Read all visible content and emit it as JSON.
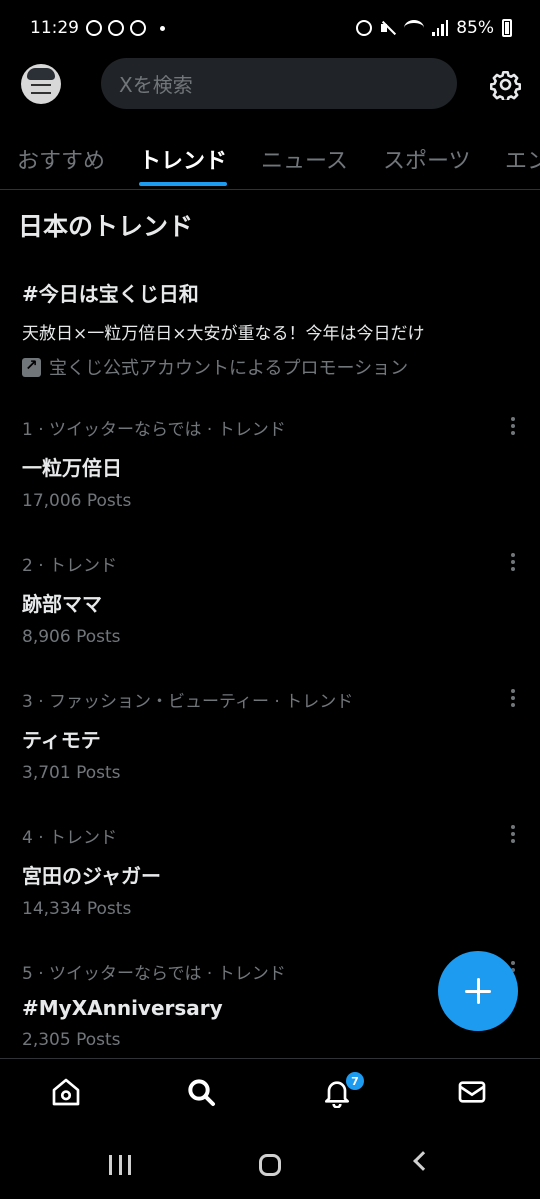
{
  "status_bar": {
    "time": "11:29",
    "battery": "85%"
  },
  "header": {
    "search_placeholder": "Xを検索",
    "avatar_icon": "avatar-icon",
    "settings_icon": "gear-icon"
  },
  "tabs": [
    {
      "label": "おすすめ",
      "active": false
    },
    {
      "label": "トレンド",
      "active": true
    },
    {
      "label": "ニュース",
      "active": false
    },
    {
      "label": "スポーツ",
      "active": false
    },
    {
      "label": "エン",
      "active": false
    }
  ],
  "section_title": "日本のトレンド",
  "promoted": {
    "title": "#今日は宝くじ日和",
    "description": "天赦日×一粒万倍日×大安が重なる！今年は今日だけ",
    "promoted_by": "宝くじ公式アカウントによるプロモーション"
  },
  "trends": [
    {
      "meta": "1 · ツイッターならでは · トレンド",
      "name": "一粒万倍日",
      "posts": "17,006 Posts"
    },
    {
      "meta": "2 · トレンド",
      "name": "跡部ママ",
      "posts": "8,906 Posts"
    },
    {
      "meta": "3 · ファッション・ビューティー · トレンド",
      "name": "ティモテ",
      "posts": "3,701 Posts"
    },
    {
      "meta": "4 · トレンド",
      "name": "宮田のジャガー",
      "posts": "14,334 Posts"
    },
    {
      "meta": "5 · ツイッターならでは · トレンド",
      "name": "#MyXAnniversary",
      "posts": "2,305 Posts"
    }
  ],
  "bottom_nav": {
    "notifications_badge": "7",
    "icons": [
      "home-icon",
      "search-icon",
      "bell-icon",
      "mail-icon"
    ]
  },
  "accent_color": "#1d9bf0"
}
